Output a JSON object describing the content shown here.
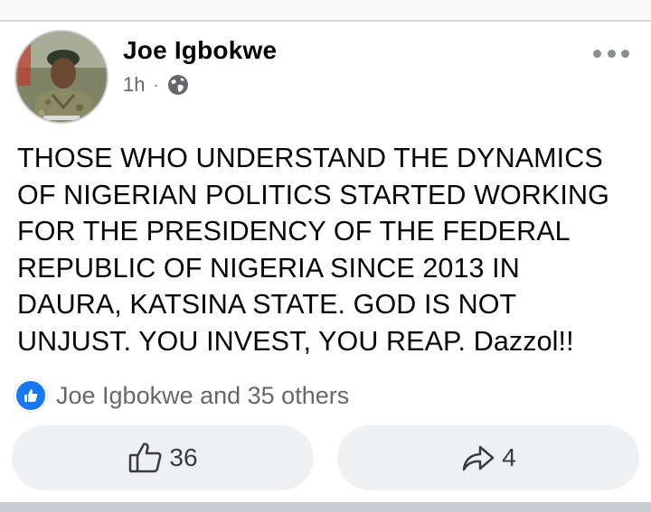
{
  "post": {
    "author": "Joe Igbokwe",
    "time": "1h",
    "separator": "·",
    "audience_icon": "globe-icon",
    "body": "THOSE WHO UNDERSTAND THE DYNAMICS\nOF NIGERIAN POLITICS STARTED WORKING\nFOR THE PRESIDENCY OF THE FEDERAL\nREPUBLIC OF NIGERIA SINCE 2013 IN\nDAURA, KATSINA STATE. GOD IS NOT\nUNJUST. YOU INVEST, YOU REAP. Dazzol!!",
    "reactions_summary": "Joe Igbokwe and 35 others",
    "like_count": "36",
    "share_count": "4"
  },
  "colors": {
    "accent": "#1877f2",
    "secondary_text": "#65676b",
    "button_bg": "#eff0f2"
  }
}
